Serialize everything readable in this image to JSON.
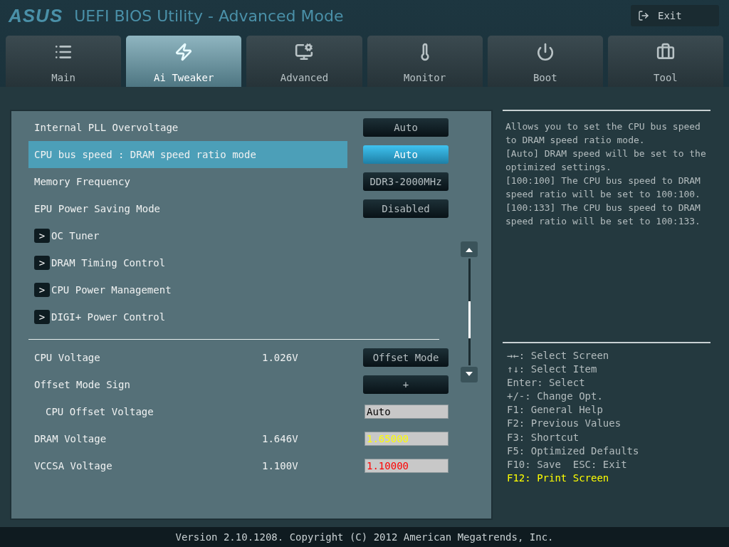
{
  "header": {
    "brand": "ASUS",
    "title": "UEFI BIOS Utility - Advanced Mode",
    "exit_button": "Exit"
  },
  "tabs": [
    {
      "label": "Main",
      "selected": false
    },
    {
      "label": "Ai Tweaker",
      "selected": true
    },
    {
      "label": "Advanced",
      "selected": false
    },
    {
      "label": "Monitor",
      "selected": false
    },
    {
      "label": "Boot",
      "selected": false
    },
    {
      "label": "Tool",
      "selected": false
    }
  ],
  "sections": [
    {
      "items": [
        {
          "kind": "option",
          "label": "Internal PLL Overvoltage",
          "value": "Auto",
          "selected": false
        },
        {
          "kind": "option",
          "label": "CPU bus speed : DRAM speed ratio mode",
          "value": "Auto",
          "selected": true
        },
        {
          "kind": "option",
          "label": "Memory Frequency",
          "value": "DDR3-2000MHz",
          "selected": false
        },
        {
          "kind": "option",
          "label": "EPU Power Saving Mode",
          "value": "Disabled",
          "selected": false
        },
        {
          "kind": "submenu",
          "label": "OC Tuner",
          "arrow": ">",
          "selected": false
        },
        {
          "kind": "submenu",
          "label": "DRAM Timing Control",
          "arrow": ">",
          "selected": false
        },
        {
          "kind": "submenu",
          "label": "CPU Power Management",
          "arrow": ">",
          "selected": false
        },
        {
          "kind": "submenu",
          "label": "DIGI+ Power Control",
          "arrow": ">",
          "selected": false
        }
      ]
    },
    {
      "items": [
        {
          "kind": "option",
          "label": "CPU Voltage",
          "reading": "1.026V",
          "value": "Offset Mode",
          "selected": false
        },
        {
          "kind": "option",
          "label": "Offset Mode Sign",
          "value": "+",
          "selected": false
        },
        {
          "kind": "field",
          "label": "CPU Offset Voltage",
          "value": "Auto",
          "color": "#000000",
          "selected": false,
          "indented": true
        },
        {
          "kind": "field",
          "label": "DRAM Voltage",
          "reading": "1.646V",
          "value": "1.65000",
          "color": "#ffff00",
          "selected": false
        },
        {
          "kind": "field",
          "label": "VCCSA Voltage",
          "reading": "1.100V",
          "value": "1.10000",
          "color": "#ff0000",
          "selected": false
        }
      ]
    }
  ],
  "help": {
    "text": "Allows you to set the CPU bus speed to DRAM speed ratio mode.\n[Auto] DRAM speed will be set to the optimized settings.\n[100:100] The CPU bus speed to DRAM speed ratio will be set to 100:100.\n[100:133] The CPU bus speed to DRAM speed ratio will be set to 100:133."
  },
  "keys": [
    {
      "text": "→←: Select Screen",
      "highlighted": false
    },
    {
      "text": "↑↓: Select Item",
      "highlighted": false
    },
    {
      "text": "Enter: Select",
      "highlighted": false
    },
    {
      "text": "+/-: Change Opt.",
      "highlighted": false
    },
    {
      "text": "F1: General Help",
      "highlighted": false
    },
    {
      "text": "F2: Previous Values",
      "highlighted": false
    },
    {
      "text": "F3: Shortcut",
      "highlighted": false
    },
    {
      "text": "F5: Optimized Defaults",
      "highlighted": false
    },
    {
      "text": "F10: Save  ESC: Exit",
      "highlighted": false
    },
    {
      "text": "F12: Print Screen",
      "highlighted": true
    }
  ],
  "footer": "Version 2.10.1208. Copyright (C) 2012 American Megatrends, Inc."
}
